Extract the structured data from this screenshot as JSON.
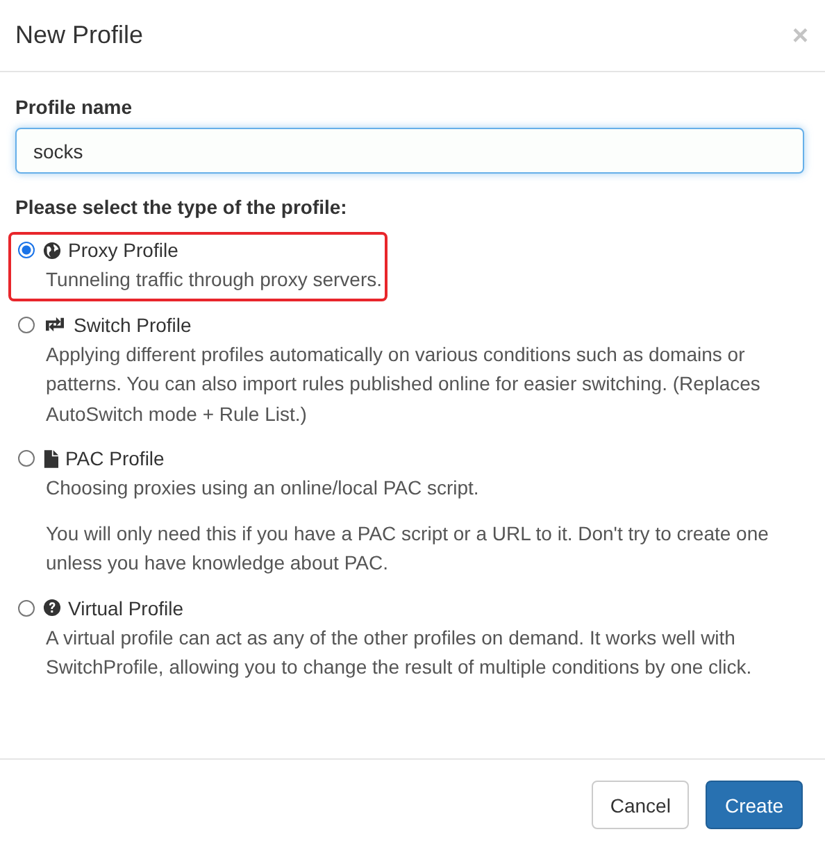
{
  "dialog": {
    "title": "New Profile",
    "close": "×"
  },
  "name_field": {
    "label": "Profile name",
    "value": "socks",
    "focused": true
  },
  "type_group": {
    "label": "Please select the type of the profile:",
    "options": [
      {
        "kind": "globe",
        "title": "Proxy Profile",
        "selected": true,
        "highlighted": true,
        "paragraphs": [
          "Tunneling traffic through proxy servers."
        ]
      },
      {
        "kind": "switch",
        "title": "Switch Profile",
        "selected": false,
        "highlighted": false,
        "paragraphs": [
          "Applying different profiles automatically on various conditions such as domains or patterns. You can also import rules published online for easier switching. (Replaces AutoSwitch mode + Rule List.)"
        ]
      },
      {
        "kind": "file",
        "title": "PAC Profile",
        "selected": false,
        "highlighted": false,
        "paragraphs": [
          "Choosing proxies using an online/local PAC script.",
          "You will only need this if you have a PAC script or a URL to it. Don't try to create one unless you have knowledge about PAC."
        ]
      },
      {
        "kind": "question",
        "title": "Virtual Profile",
        "selected": false,
        "highlighted": false,
        "paragraphs": [
          "A virtual profile can act as any of the other profiles on demand. It works well with SwitchProfile, allowing you to change the result of multiple conditions by one click."
        ]
      }
    ]
  },
  "buttons": [
    {
      "label": "Cancel",
      "kind": "default"
    },
    {
      "label": "Create",
      "kind": "primary"
    }
  ]
}
